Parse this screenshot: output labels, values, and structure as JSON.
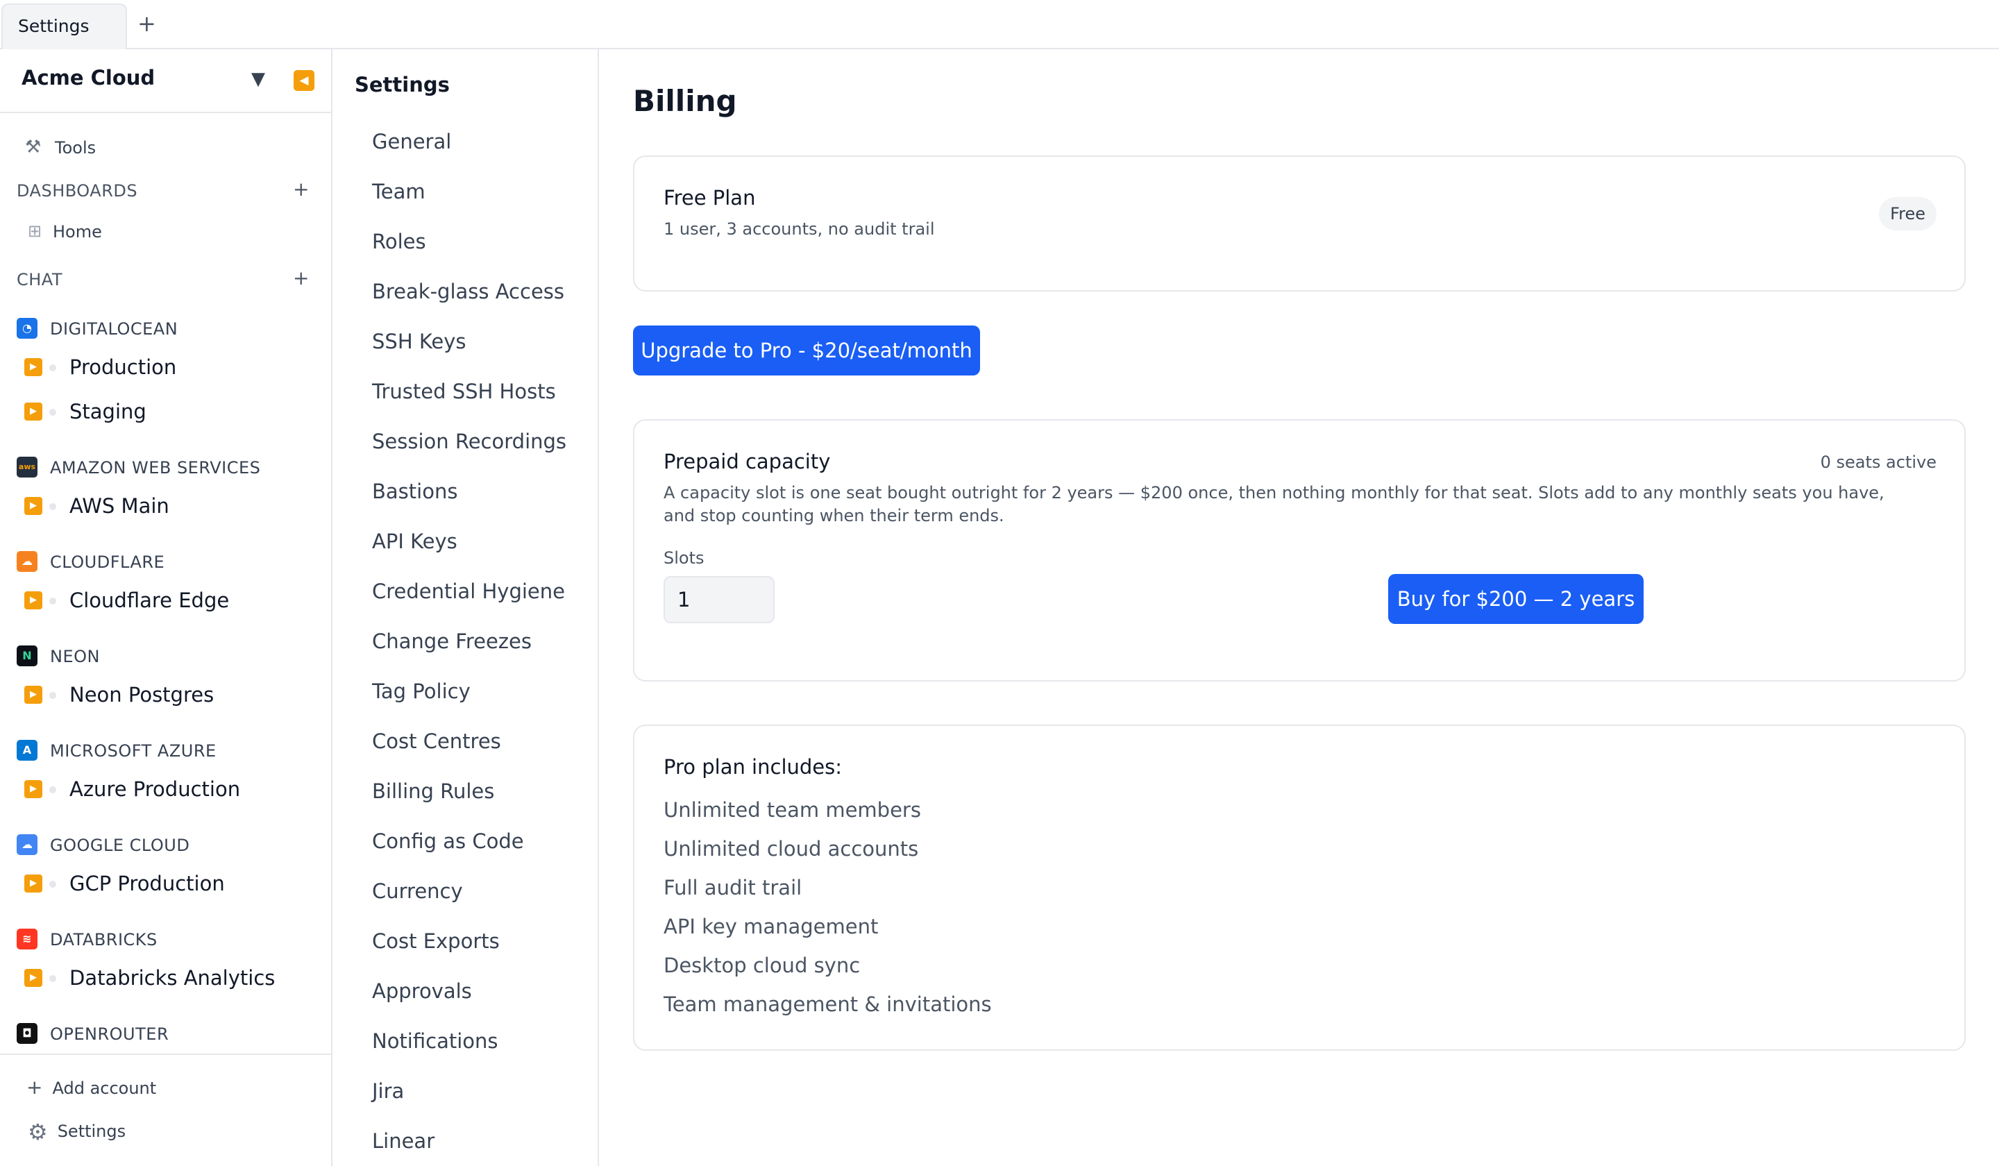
{
  "tabs": [
    {
      "label": "Settings"
    }
  ],
  "new_tab_label": "+",
  "sidebar": {
    "title": "Acme Cloud",
    "tools_label": "Tools",
    "dashboards_label": "DASHBOARDS",
    "home_label": "Home",
    "chat_label": "CHAT",
    "providers": [
      {
        "name": "DIGITALOCEAN",
        "icon": "digitalocean-icon",
        "color": "#1a73e8",
        "accounts": [
          "Production",
          "Staging"
        ]
      },
      {
        "name": "AMAZON WEB SERVICES",
        "icon": "aws-icon",
        "color": "#232f3e",
        "accounts": [
          "AWS Main"
        ]
      },
      {
        "name": "CLOUDFLARE",
        "icon": "cloudflare-icon",
        "color": "#f6821f",
        "accounts": [
          "Cloudflare Edge"
        ]
      },
      {
        "name": "NEON",
        "icon": "neon-icon",
        "color": "#0d1117",
        "accounts": [
          "Neon Postgres"
        ]
      },
      {
        "name": "MICROSOFT AZURE",
        "icon": "azure-icon",
        "color": "#0078d4",
        "accounts": [
          "Azure Production"
        ]
      },
      {
        "name": "GOOGLE CLOUD",
        "icon": "google-cloud-icon",
        "color": "#4285f4",
        "accounts": [
          "GCP Production"
        ]
      },
      {
        "name": "DATABRICKS",
        "icon": "databricks-icon",
        "color": "#ff3621",
        "accounts": [
          "Databricks Analytics"
        ]
      },
      {
        "name": "OPENROUTER",
        "icon": "openrouter-icon",
        "color": "#111111",
        "accounts": []
      }
    ],
    "add_account_label": "Add account",
    "settings_label": "Settings"
  },
  "settings_nav": {
    "title": "Settings",
    "items": [
      "General",
      "Team",
      "Roles",
      "Break-glass Access",
      "SSH Keys",
      "Trusted SSH Hosts",
      "Session Recordings",
      "Bastions",
      "API Keys",
      "Credential Hygiene",
      "Change Freezes",
      "Tag Policy",
      "Cost Centres",
      "Billing Rules",
      "Config as Code",
      "Currency",
      "Cost Exports",
      "Approvals",
      "Notifications",
      "Jira",
      "Linear"
    ]
  },
  "billing": {
    "title": "Billing",
    "plan": {
      "name": "Free Plan",
      "description": "1 user, 3 accounts, no audit trail",
      "badge": "Free"
    },
    "upgrade_button": "Upgrade to Pro - $20/seat/month",
    "capacity": {
      "title": "Prepaid capacity",
      "seats_active": "0 seats active",
      "description": "A capacity slot is one seat bought outright for 2 years — $200 once, then nothing monthly for that seat. Slots add to any monthly seats you have, and stop counting when their term ends.",
      "slots_label": "Slots",
      "slots_value": "1",
      "buy_button": "Buy for $200 — 2 years"
    },
    "pro": {
      "title": "Pro plan includes:",
      "features": [
        "Unlimited team members",
        "Unlimited cloud accounts",
        "Full audit trail",
        "API key management",
        "Desktop cloud sync",
        "Team management & invitations"
      ]
    }
  },
  "colors": {
    "accent": "#1a5ef5",
    "account_badge": "#f59e0b"
  }
}
